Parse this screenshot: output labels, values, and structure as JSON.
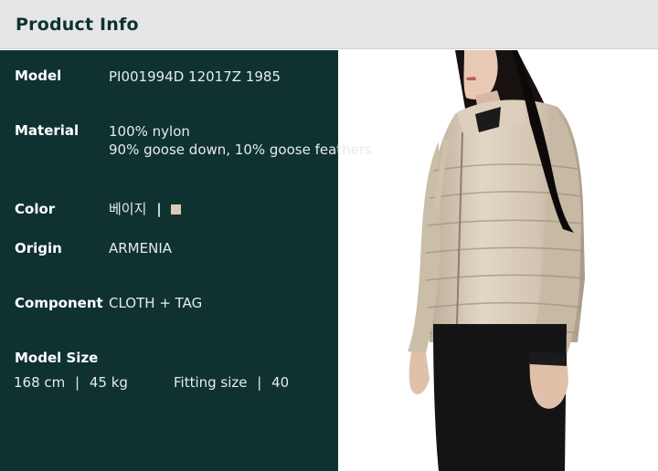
{
  "header": {
    "title": "Product Info"
  },
  "specs": {
    "model": {
      "label": "Model",
      "value": "PI001994D 12017Z 1985"
    },
    "material": {
      "label": "Material",
      "lines": [
        "100% nylon",
        "90% goose down, 10% goose feathers"
      ]
    },
    "color": {
      "label": "Color",
      "value": "베이지",
      "separator": "|",
      "swatch_color": "#d9cbb8"
    },
    "origin": {
      "label": "Origin",
      "value": "ARMENIA"
    },
    "component": {
      "label": "Component",
      "value": "CLOTH + TAG"
    }
  },
  "model_size": {
    "label": "Model Size",
    "height": "168 cm",
    "weight": "45 kg",
    "fitting_label": "Fitting size",
    "fitting_value": "40",
    "separator": "|"
  },
  "colors": {
    "panel_bg": "#0f3231",
    "header_bg": "#e6e6e6",
    "jacket": "#d6cab7"
  }
}
